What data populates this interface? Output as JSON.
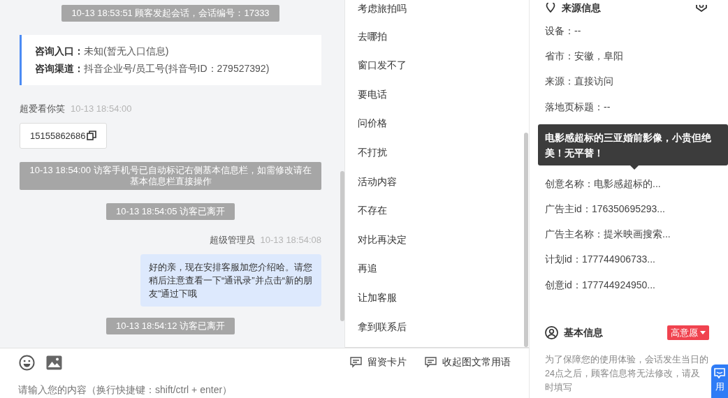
{
  "chat": {
    "messages": [
      {
        "kind": "system",
        "text": "10-13 18:53:51 顾客发起会话，会话编号：17333"
      },
      {
        "kind": "info",
        "rows": [
          {
            "label": "咨询入口：",
            "value": "未知(暂无入口信息)"
          },
          {
            "label": "咨询渠道：",
            "value": "抖音企业号/员工号(抖音号ID：279527392)"
          }
        ]
      },
      {
        "kind": "visitor",
        "sender": "超爱看你笑",
        "time": "10-13 18:54:00",
        "text": "15155862686"
      },
      {
        "kind": "system",
        "text": "10-13 18:54:00 访客手机号已自动标记右侧基本信息栏，如需修改请在基本信息栏直接操作"
      },
      {
        "kind": "system",
        "text": "10-13 18:54:05 访客已离开"
      },
      {
        "kind": "agent",
        "sender": "超级管理员",
        "time": "10-13 18:54:08",
        "text": "好的亲，现在安排客服加您介绍哈。请您稍后注意查看一下“通讯录”并点击“新的朋友”通过下哦"
      },
      {
        "kind": "system",
        "text": "10-13 18:54:12 访客已离开"
      }
    ]
  },
  "quick_replies": [
    "考虑旅拍吗",
    "去哪拍",
    "窗口发不了",
    "要电话",
    "问价格",
    "不打扰",
    "活动内容",
    "不存在",
    "对比再决定",
    "再追",
    "让加客服",
    "拿到联系后"
  ],
  "composer": {
    "placeholder": "请输入您的内容（换行快捷键：shift/ctrl + enter）",
    "actions": [
      {
        "label": "留资卡片"
      },
      {
        "label": "收起图文常用语"
      }
    ]
  },
  "source_info": {
    "title": "来源信息",
    "rows": [
      {
        "kind": "text",
        "text": "设备：--"
      },
      {
        "kind": "text",
        "text": "省市：安徽，阜阳"
      },
      {
        "kind": "text",
        "text": "来源：直接访问"
      },
      {
        "kind": "text",
        "text": "落地页标题：--"
      },
      {
        "kind": "tooltip",
        "text": "电影感超标的三亚婚前影像，小贵但绝美！无平替！"
      },
      {
        "kind": "text",
        "text": "创意名称：电影感超标的..."
      },
      {
        "kind": "text",
        "text": "广告主id：176350695293..."
      },
      {
        "kind": "text",
        "text": "广告主名称：提米映画搜索..."
      },
      {
        "kind": "text",
        "text": "计划id：177744906733..."
      },
      {
        "kind": "text",
        "text": "创意id：177744924950..."
      }
    ]
  },
  "basic_info": {
    "title": "基本信息",
    "intent": {
      "label": "高意愿",
      "color": "#f0434f"
    },
    "note": "为了保障您的使用体验，会话发生当日的24点之后，顾客信息将无法修改，请及时填写"
  },
  "float_button": {
    "label": "用"
  }
}
